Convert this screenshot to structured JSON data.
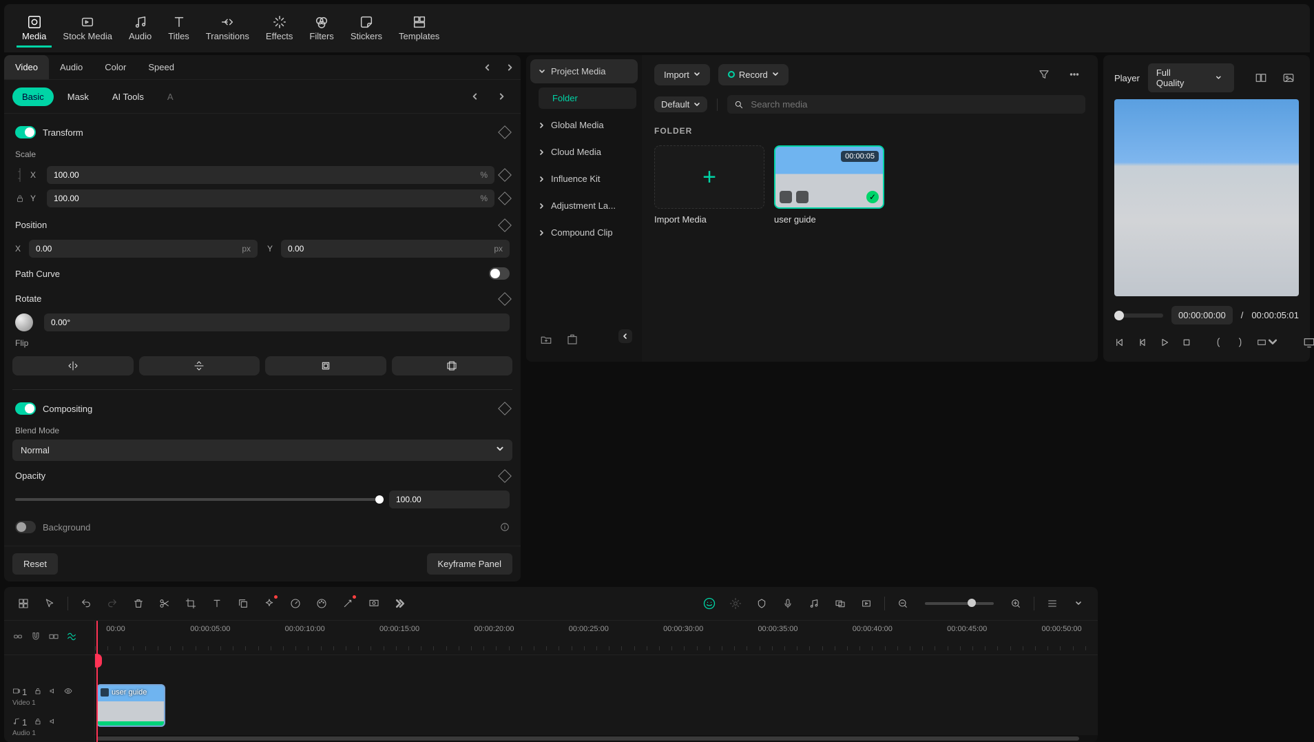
{
  "top_tabs": [
    {
      "id": "media",
      "label": "Media",
      "icon": "media"
    },
    {
      "id": "stock",
      "label": "Stock Media",
      "icon": "stock"
    },
    {
      "id": "audio",
      "label": "Audio",
      "icon": "audio"
    },
    {
      "id": "titles",
      "label": "Titles",
      "icon": "titles"
    },
    {
      "id": "transitions",
      "label": "Transitions",
      "icon": "trans"
    },
    {
      "id": "effects",
      "label": "Effects",
      "icon": "effects"
    },
    {
      "id": "filters",
      "label": "Filters",
      "icon": "filters"
    },
    {
      "id": "stickers",
      "label": "Stickers",
      "icon": "stickers"
    },
    {
      "id": "templates",
      "label": "Templates",
      "icon": "templates"
    }
  ],
  "media_side": {
    "project": "Project Media",
    "folder": "Folder",
    "items": [
      "Global Media",
      "Cloud Media",
      "Influence Kit",
      "Adjustment La...",
      "Compound Clip"
    ]
  },
  "media": {
    "import": "Import",
    "record": "Record",
    "default": "Default",
    "search_ph": "Search media",
    "crumb": "FOLDER",
    "import_media": "Import Media",
    "clip_name": "user guide",
    "clip_dur": "00:00:05"
  },
  "player": {
    "label": "Player",
    "quality": "Full Quality",
    "cur": "00:00:00:00",
    "sep": "/",
    "total": "00:00:05:01"
  },
  "inspector": {
    "tabs": [
      "Video",
      "Audio",
      "Color",
      "Speed"
    ],
    "subtabs": [
      "Basic",
      "Mask",
      "AI Tools",
      "A"
    ],
    "sections": {
      "transform": "Transform",
      "scale": "Scale",
      "scale_x": "100.00",
      "scale_y": "100.00",
      "pct": "%",
      "X": "X",
      "Y": "Y",
      "position": "Position",
      "pos_x": "0.00",
      "pos_y": "0.00",
      "px": "px",
      "pathcurve": "Path Curve",
      "rotate": "Rotate",
      "rot_val": "0.00°",
      "flip": "Flip",
      "compositing": "Compositing",
      "blend": "Blend Mode",
      "blend_val": "Normal",
      "opacity": "Opacity",
      "opacity_val": "100.00",
      "background": "Background"
    },
    "reset": "Reset",
    "keyframe": "Keyframe Panel"
  },
  "timeline": {
    "ticks": [
      "00:00",
      "00:00:05:00",
      "00:00:10:00",
      "00:00:15:00",
      "00:00:20:00",
      "00:00:25:00",
      "00:00:30:00",
      "00:00:35:00",
      "00:00:40:00",
      "00:00:45:00",
      "00:00:50:00"
    ],
    "tracks": {
      "video": "Video 1",
      "audio": "Audio 1",
      "v": "1",
      "a": "1"
    },
    "clip": "user guide"
  }
}
